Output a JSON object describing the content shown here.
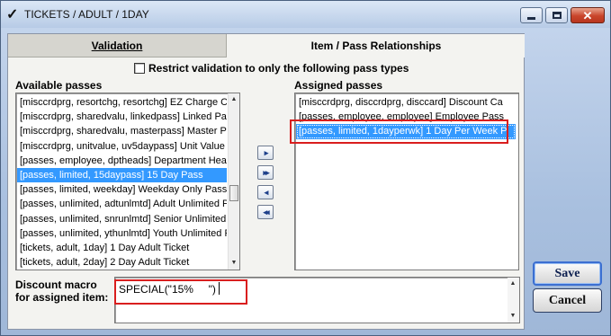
{
  "window": {
    "title": "TICKETS / ADULT / 1DAY",
    "close_glyph": "✕"
  },
  "tabs": {
    "validation": "Validation",
    "item_pass": "Item / Pass Relationships"
  },
  "restrict": {
    "label": "Restrict validation to only the following pass types",
    "checked": false
  },
  "available": {
    "label": "Available passes",
    "items": [
      "[misccrdprg, resortchg, resortchg] EZ Charge C",
      "[misccrdprg, sharedvalu, linkedpass] Linked Pas",
      "[misccrdprg, sharedvalu, masterpass] Master P",
      "[misccrdprg, unitvalue, uv5daypass] Unit Value",
      "[passes, employee, dptheads] Department Head",
      "[passes, limited, 15daypass] 15 Day Pass",
      "[passes, limited, weekday] Weekday Only Pass",
      "[passes, unlimited, adtunlmtd] Adult Unlimited P",
      "[passes, unlimited, snrunlmtd] Senior Unlimited P",
      "[passes, unlimited, ythunlmtd] Youth Unlimited P",
      "[tickets, adult, 1day] 1 Day Adult Ticket",
      "[tickets, adult, 2day] 2 Day Adult Ticket"
    ],
    "selected_index": 5
  },
  "assigned": {
    "label": "Assigned passes",
    "items": [
      "[misccrdprg, disccrdprg, disccard] Discount Ca",
      "[passes, employee, employee] Employee Pass",
      "[passes, limited, 1dayperwk] 1 Day Per Week P"
    ],
    "selected_index": 2
  },
  "move_buttons": {
    "add_one": "▸",
    "add_all": "▸▸",
    "remove_one": "◂",
    "remove_all": "◂◂"
  },
  "macro": {
    "label_line1": "Discount macro",
    "label_line2": "for assigned item:",
    "value": "SPECIAL(\"15%     \")"
  },
  "buttons": {
    "save": "Save",
    "cancel": "Cancel"
  },
  "colors": {
    "selection": "#3399ff",
    "highlight_box": "#d91e1e",
    "save_border": "#3b6fd1"
  }
}
